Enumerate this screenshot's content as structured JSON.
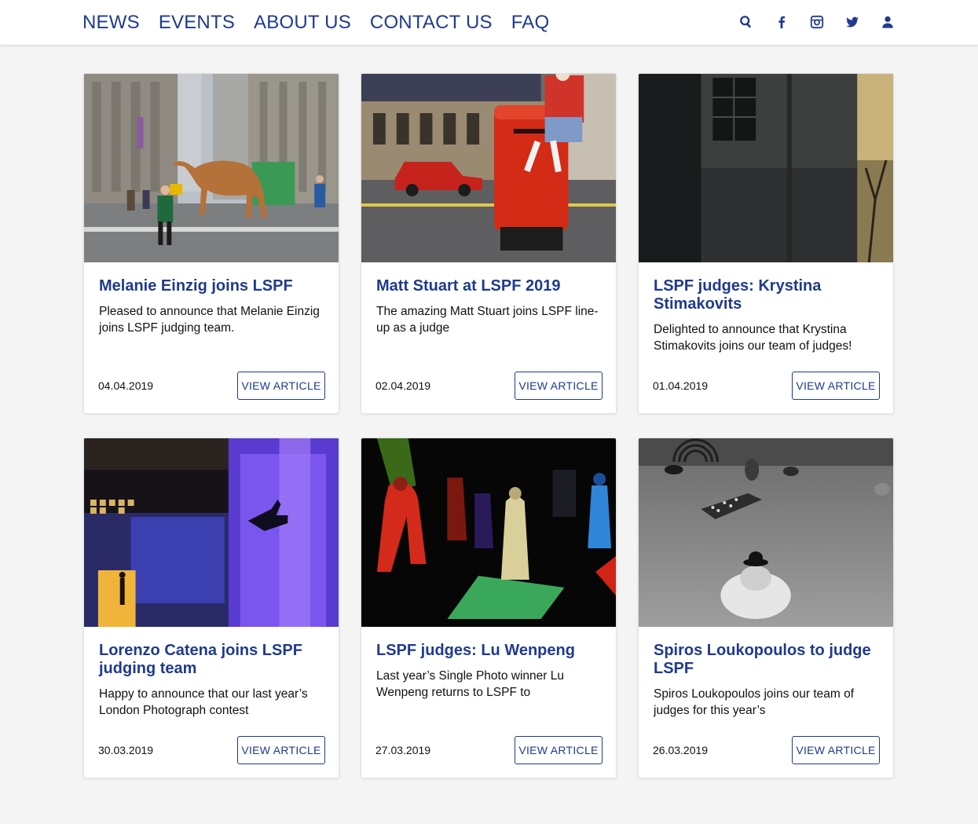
{
  "nav": {
    "items": [
      "NEWS",
      "EVENTS",
      "ABOUT US",
      "CONTACT US",
      "FAQ"
    ],
    "icons": [
      "search-icon",
      "facebook-icon",
      "instagram-icon",
      "twitter-icon",
      "user-icon"
    ]
  },
  "colors": {
    "accent": "#1f3a8f",
    "background": "#f4f4f4"
  },
  "cards": [
    {
      "title": "Melanie Einzig joins LSPF",
      "text": "Pleased to announce that Melanie Einzig joins LSPF judging team.",
      "date": "04.04.2019",
      "button": "VIEW ARTICLE"
    },
    {
      "title": "Matt Stuart at LSPF 2019",
      "text": "The amazing Matt Stuart joins LSPF line-up as a judge",
      "date": "02.04.2019",
      "button": "VIEW ARTICLE"
    },
    {
      "title": "LSPF judges: Krystina Stimakovits",
      "text": "Delighted to announce that Krystina Stimakovits joins our team of judges!",
      "date": "01.04.2019",
      "button": "VIEW ARTICLE"
    },
    {
      "title": "Lorenzo Catena joins LSPF judging team",
      "text": "Happy to announce that our last year’s London Photograph contest",
      "date": "30.03.2019",
      "button": "VIEW ARTICLE"
    },
    {
      "title": "LSPF judges: Lu Wenpeng",
      "text": "Last year’s Single Photo winner Lu Wenpeng returns to LSPF to",
      "date": "27.03.2019",
      "button": "VIEW ARTICLE"
    },
    {
      "title": "Spiros Loukopoulos to judge LSPF",
      "text": "Spiros Loukopoulos joins our team of judges for this year’s",
      "date": "26.03.2019",
      "button": "VIEW ARTICLE"
    }
  ]
}
